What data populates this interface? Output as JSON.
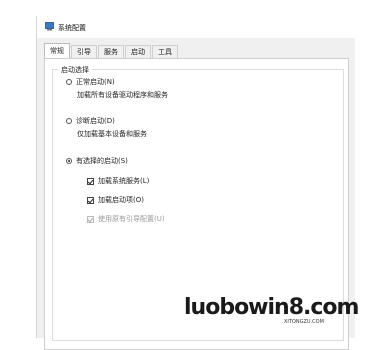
{
  "window": {
    "title": "系统配置"
  },
  "tabs": [
    {
      "label": "常规",
      "active": true
    },
    {
      "label": "引导",
      "active": false
    },
    {
      "label": "服务",
      "active": false
    },
    {
      "label": "启动",
      "active": false
    },
    {
      "label": "工具",
      "active": false
    }
  ],
  "startup": {
    "group_label": "启动选择",
    "normal_label": "正常启动(N)",
    "normal_desc": "加载所有设备驱动程序和服务",
    "diagnostic_label": "诊断启动(D)",
    "diagnostic_desc": "仅加载基本设备和服务",
    "selective_label": "有选择的启动(S)",
    "selected": "selective",
    "options": {
      "load_services_label": "加载系统服务(L)",
      "load_services_checked": true,
      "load_startup_label": "加载启动项(O)",
      "load_startup_checked": true,
      "use_boot_label": "使用原有引导配置(U)",
      "use_boot_checked": true,
      "use_boot_enabled": false
    }
  },
  "watermark": {
    "text": "luobowin8.com",
    "subtext": "XITONGZU.COM"
  }
}
